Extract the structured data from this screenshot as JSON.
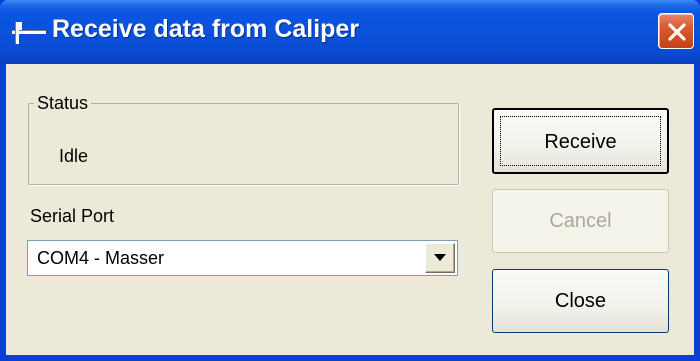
{
  "window": {
    "title": "Receive data from Caliper"
  },
  "status": {
    "legend": "Status",
    "value": "Idle"
  },
  "serial_port": {
    "label": "Serial Port",
    "selected": "COM4 - Masser"
  },
  "buttons": {
    "receive": "Receive",
    "cancel": "Cancel",
    "close": "Close"
  },
  "colors": {
    "titlebar": "#0a4fd8",
    "close_button": "#d95a30",
    "dialog_background": "#ece9d8",
    "disabled_text": "#aca899"
  },
  "icons": {
    "title": "caliper-icon",
    "close": "close-icon",
    "dropdown": "chevron-down-icon"
  }
}
